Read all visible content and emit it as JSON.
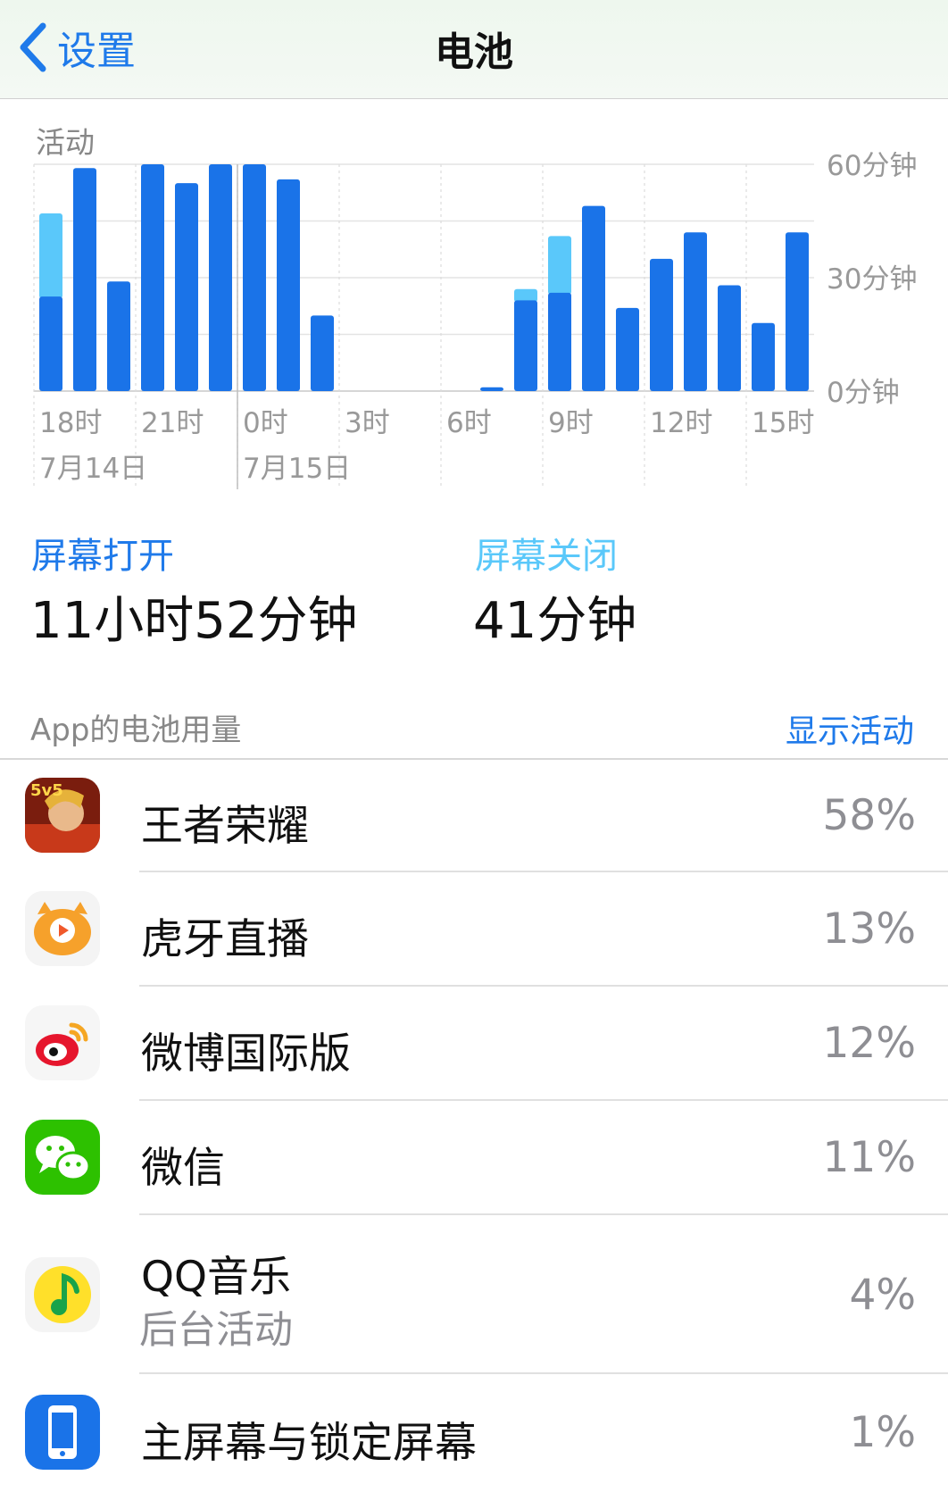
{
  "nav": {
    "back_label": "设置",
    "title": "电池"
  },
  "activity": {
    "label": "活动"
  },
  "chart_data": {
    "type": "bar",
    "stacked": true,
    "ylabel": "",
    "ylim": [
      0,
      60
    ],
    "yticks": [
      "60分钟",
      "30分钟",
      "0分钟"
    ],
    "hour_labels": [
      "18时",
      "21时",
      "0时",
      "3时",
      "6时",
      "9时",
      "12时",
      "15时"
    ],
    "date_labels": [
      "7月14日",
      "7月15日"
    ],
    "grid": true,
    "series": [
      {
        "name": "",
        "color": "#1a73e8",
        "values": [
          25,
          59,
          29,
          60,
          55,
          60,
          60,
          56,
          20,
          0,
          0,
          0,
          0,
          1,
          24,
          26,
          49,
          22,
          35,
          42,
          28,
          18,
          42
        ]
      },
      {
        "name": "",
        "color": "#5ac8fa",
        "values": [
          22,
          0,
          0,
          0,
          0,
          0,
          0,
          0,
          0,
          0,
          0,
          0,
          0,
          0,
          3,
          15,
          0,
          0,
          0,
          0,
          0,
          0,
          0
        ]
      }
    ]
  },
  "stats": {
    "screen_on": {
      "label": "屏幕打开",
      "value": "11小时52分钟",
      "color": "#1f7aea"
    },
    "screen_off": {
      "label": "屏幕关闭",
      "value": "41分钟",
      "color": "#5ac8fa"
    }
  },
  "app_section": {
    "header": "App的电池用量",
    "show_activity": "显示活动"
  },
  "apps": [
    {
      "name": "王者荣耀",
      "percent": "58%",
      "icon": "honor-of-kings-icon"
    },
    {
      "name": "虎牙直播",
      "percent": "13%",
      "icon": "huya-icon"
    },
    {
      "name": "微博国际版",
      "percent": "12%",
      "icon": "weibo-icon"
    },
    {
      "name": "微信",
      "percent": "11%",
      "icon": "wechat-icon"
    },
    {
      "name": "QQ音乐",
      "sub": "后台活动",
      "percent": "4%",
      "icon": "qq-music-icon"
    },
    {
      "name": "主屏幕与锁定屏幕",
      "percent": "1%",
      "icon": "home-lock-screen-icon"
    }
  ]
}
